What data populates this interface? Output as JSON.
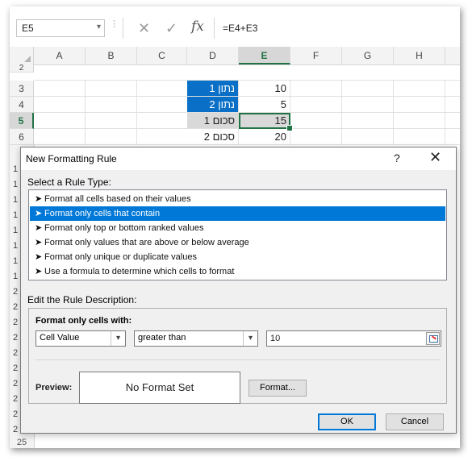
{
  "formula_bar": {
    "name_box": "E5",
    "separator": "⋮",
    "cancel_glyph": "✕",
    "enter_glyph": "✓",
    "fx_glyph": "fx",
    "formula": "=E4+E3"
  },
  "sheet": {
    "columns": [
      "A",
      "B",
      "C",
      "D",
      "E",
      "F",
      "G",
      "H"
    ],
    "active_column": "E",
    "rows": [
      "2",
      "3",
      "4",
      "5",
      "6"
    ],
    "active_row": "5",
    "hidden_row_stubs": [
      "1",
      "1",
      "1",
      "1",
      "1",
      "1",
      "1",
      "1",
      "2",
      "2",
      "2",
      "2",
      "2",
      "2",
      "2",
      "2",
      "2",
      "2"
    ],
    "bottom_row": "25",
    "cells": {
      "D3": "נתון 1",
      "E3": "10",
      "D4": "נתון 2",
      "E4": "5",
      "D5": "סכום 1",
      "E5": "15",
      "D6": "סכום 2",
      "E6": "20"
    },
    "colors": {
      "blue_fill": "#0a6fc6",
      "grey_fill": "#d9d9d9",
      "selection": "#217346"
    }
  },
  "dialog": {
    "title": "New Formatting Rule",
    "help": "?",
    "close": "✕",
    "rule_type_label": "Select a Rule Type:",
    "rule_types": [
      "Format all cells based on their values",
      "Format only cells that contain",
      "Format only top or bottom ranked values",
      "Format only values that are above or below average",
      "Format only unique or duplicate values",
      "Use a formula to determine which cells to format"
    ],
    "selected_rule_index": 1,
    "rule_bullet": "➤",
    "edit_label": "Edit the Rule Description:",
    "format_only_label": "Format only cells with:",
    "condition_type": "Cell Value",
    "operator": "greater than",
    "value": "10",
    "preview_label": "Preview:",
    "preview_text": "No Format Set",
    "format_button": "Format...",
    "ok_button": "OK",
    "cancel_button": "Cancel",
    "select_arrow": "▾"
  }
}
